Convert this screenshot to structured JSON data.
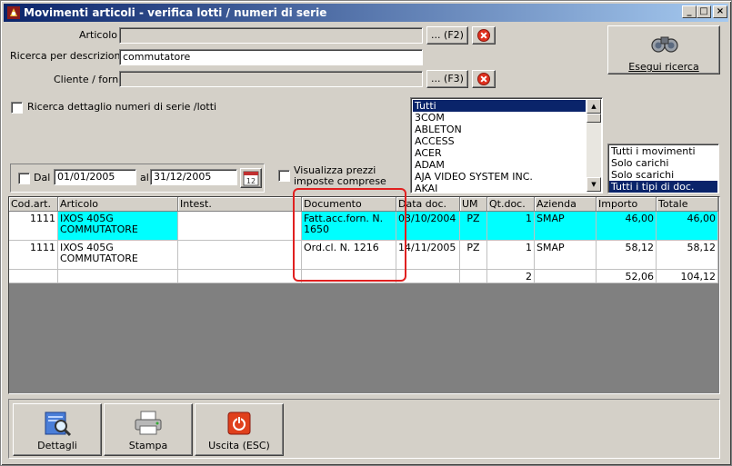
{
  "window": {
    "title": "Movimenti articoli - verifica lotti / numeri di serie",
    "min": "_",
    "max": "□",
    "close": "×"
  },
  "form": {
    "articolo_label": "Articolo :",
    "articolo_value": "",
    "f2_button": "... (F2)",
    "ricerca_label": "Ricerca per descrizione :",
    "ricerca_value": "commutatore",
    "cliente_label": "Cliente / forn. :",
    "cliente_value": "",
    "f3_button": "... (F3)",
    "dettaglio_label": "Ricerca dettaglio numeri di serie /lotti",
    "dal_label": "Dal",
    "dal_value": "01/01/2005",
    "al_label": "al",
    "al_value": "31/12/2005",
    "calendar_day": "12",
    "prezzi_label": "Visualizza prezzi imposte comprese",
    "search_button": "Esegui ricerca"
  },
  "aziende": [
    "Tutti",
    "3COM",
    "ABLETON",
    "ACCESS",
    "ACER",
    "ADAM",
    "AJA VIDEO SYSTEM INC.",
    "AKAI"
  ],
  "aziende_selected": 0,
  "movimenti": [
    "Tutti i movimenti",
    "Solo carichi",
    "Solo scarichi",
    "Tutti i tipi di doc."
  ],
  "movimenti_selected": 3,
  "table": {
    "headers": [
      "Cod.art.",
      "Articolo",
      "Intest.",
      "Documento",
      "Data doc.",
      "UM",
      "Qt.doc.",
      "Azienda",
      "Importo",
      "Totale"
    ],
    "rows": [
      [
        "1111",
        "IXOS 405G\nCOMMUTATORE",
        "",
        "Fatt.acc.forn. N.\n1650",
        "03/10/2004",
        "PZ",
        "1",
        "SMAP",
        "46,00",
        "46,00"
      ],
      [
        "1111",
        "IXOS 405G\nCOMMUTATORE",
        "",
        "Ord.cl. N. 1216",
        "14/11/2005",
        "PZ",
        "1",
        "SMAP",
        "58,12",
        "58,12"
      ],
      [
        "",
        "",
        "",
        "",
        "",
        "",
        "2",
        "",
        "52,06",
        "104,12"
      ]
    ],
    "highlight_color": "#00ffff"
  },
  "bottom": {
    "dettagli": "Dettagli",
    "stampa": "Stampa",
    "uscita": "Uscita (ESC)"
  }
}
